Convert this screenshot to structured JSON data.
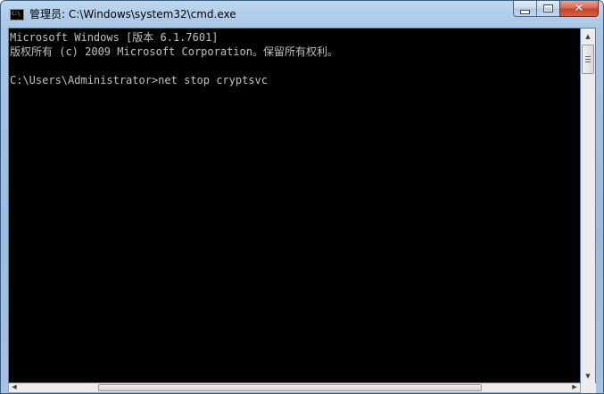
{
  "window": {
    "title": "管理员: C:\\Windows\\system32\\cmd.exe",
    "icon": "cmd-console-icon",
    "icon_text": "C:\\"
  },
  "controls": {
    "minimize_icon": "minimize-icon",
    "maximize_icon": "maximize-icon",
    "close_icon": "close-icon",
    "close_glyph": "✕"
  },
  "console": {
    "background": "#000000",
    "foreground": "#c0c0c0",
    "lines": [
      "Microsoft Windows [版本 6.1.7601]",
      "版权所有 (c) 2009 Microsoft Corporation。保留所有权利。",
      "",
      "C:\\Users\\Administrator>net stop cryptsvc"
    ]
  },
  "scrollbars": {
    "up_arrow": "▲",
    "down_arrow": "▼",
    "left_arrow": "◀",
    "right_arrow": "▶"
  }
}
